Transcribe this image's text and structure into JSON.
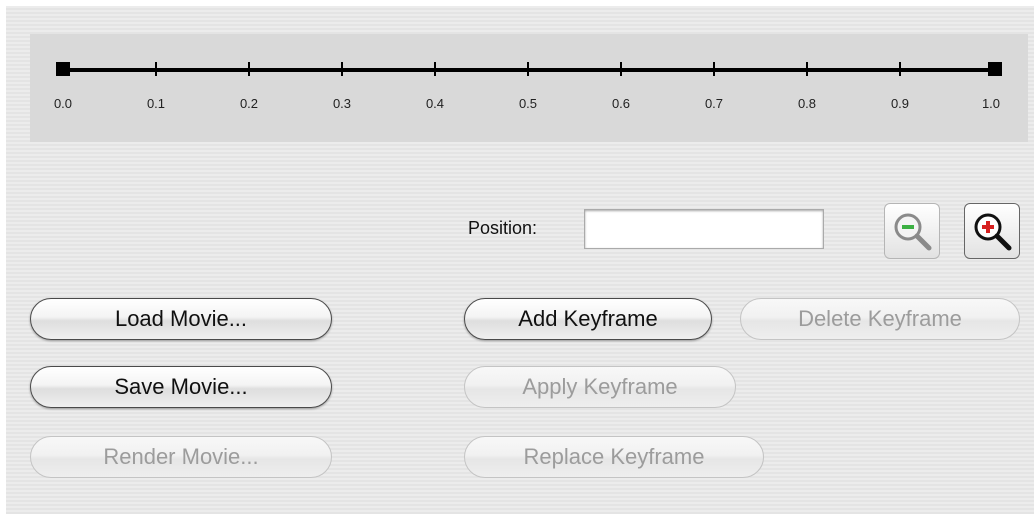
{
  "timeline": {
    "ticks": [
      "0.0",
      "0.1",
      "0.2",
      "0.3",
      "0.4",
      "0.5",
      "0.6",
      "0.7",
      "0.8",
      "0.9",
      "1.0"
    ]
  },
  "position": {
    "label": "Position:",
    "value": ""
  },
  "zoom": {
    "out_icon": "zoom-out-icon",
    "in_icon": "zoom-in-icon"
  },
  "buttons": {
    "load_movie": "Load Movie...",
    "save_movie": "Save Movie...",
    "render_movie": "Render Movie...",
    "add_keyframe": "Add Keyframe",
    "delete_keyframe": "Delete Keyframe",
    "apply_keyframe": "Apply Keyframe",
    "replace_keyframe": "Replace Keyframe"
  },
  "colors": {
    "panel": "#d9d9d9",
    "zoom_out_accent": "#3cb043",
    "zoom_in_accent": "#d62020",
    "disabled_text": "#9c9c9c"
  }
}
